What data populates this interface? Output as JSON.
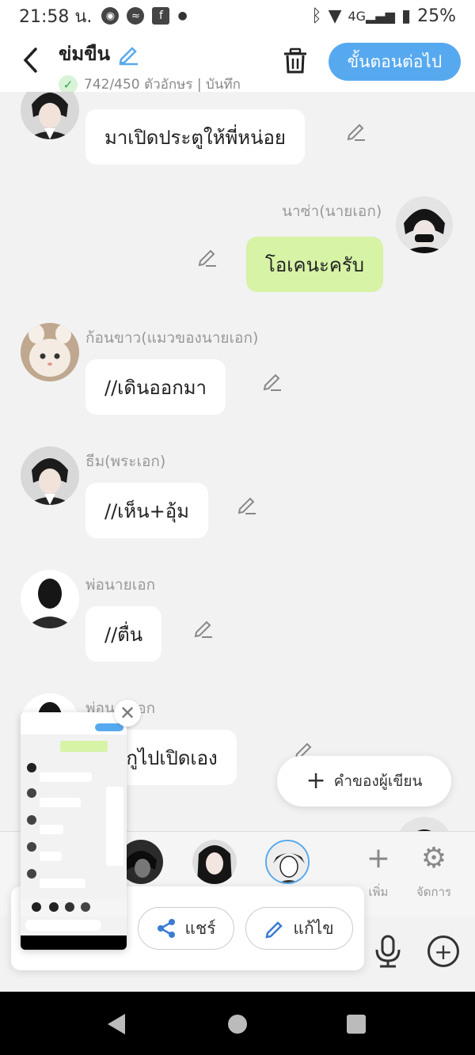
{
  "status": {
    "time": "21:58 น.",
    "battery": "25%"
  },
  "header": {
    "title": "ข่มขืน",
    "counter": "742/450 ตัวอักษร | บันทึก",
    "next_label": "ขั้นตอนต่อไป"
  },
  "messages": [
    {
      "speaker": "",
      "text": "มาเปิดประตูให้พี่หน่อย",
      "side": "left"
    },
    {
      "speaker": "นาซ่า(นายเอก)",
      "text": "โอเคนะครับ",
      "side": "right"
    },
    {
      "speaker": "ก้อนขาว(แมวของนายเอก)",
      "text": "//เดินออกมา",
      "side": "left"
    },
    {
      "speaker": "ธีม(พระเอก)",
      "text": "//เห็น+อุ้ม",
      "side": "left"
    },
    {
      "speaker": "พ่อนายเอก",
      "text": "//ตื่น",
      "side": "left"
    },
    {
      "speaker": "พ่อนายเอก",
      "text": "ยวกูไปเปิดเอง",
      "side": "left"
    }
  ],
  "writer_button_label": "คำของผู้เขียน",
  "tools": {
    "add_label": "เพิ่ม",
    "manage_label": "จัดการ"
  },
  "share_panel": {
    "share_label": "แชร์",
    "edit_label": "แก้ไข"
  },
  "colors": {
    "accent": "#57a9ef",
    "green_bubble": "#d6f3a6"
  }
}
